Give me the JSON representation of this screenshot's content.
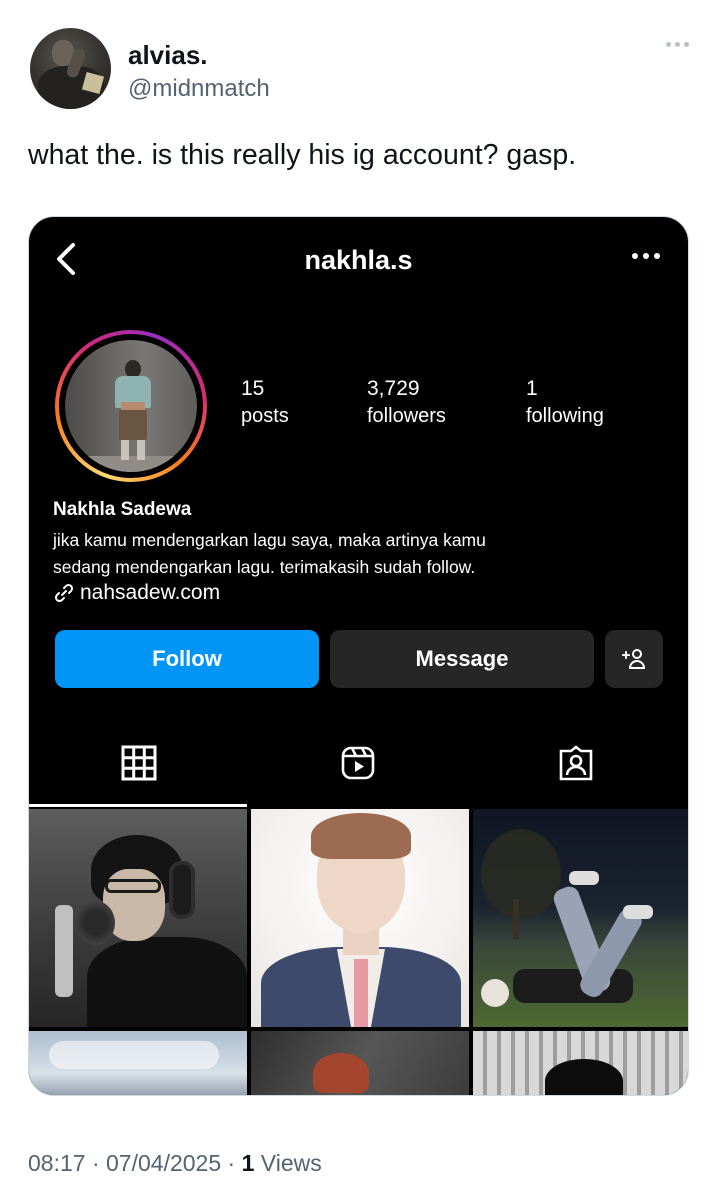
{
  "tweet": {
    "display_name": "alvias.",
    "handle": "@midnmatch",
    "text": "what the. is this really his ig account? gasp.",
    "time": "08:17",
    "sep1": "·",
    "date": "07/04/2025",
    "sep2": "·",
    "views_count": "1",
    "views_label": "Views"
  },
  "instagram": {
    "username": "nakhla.s",
    "stats": {
      "posts": {
        "num": "15",
        "label": "posts"
      },
      "followers": {
        "num": "3,729",
        "label": "followers"
      },
      "following": {
        "num": "1",
        "label": "following"
      }
    },
    "full_name": "Nakhla Sadewa",
    "bio_line1": "jika kamu mendengarkan lagu saya, maka artinya kamu",
    "bio_line2": "sedang mendengarkan lagu. terimakasih sudah follow.",
    "link": "nahsadew.com",
    "buttons": {
      "follow": "Follow",
      "message": "Message"
    },
    "colors": {
      "follow_button": "#0095f6",
      "secondary_button": "#262626",
      "background": "#000000"
    },
    "tabs": [
      "grid-icon",
      "reels-icon",
      "tagged-icon"
    ],
    "active_tab": "grid-icon"
  }
}
